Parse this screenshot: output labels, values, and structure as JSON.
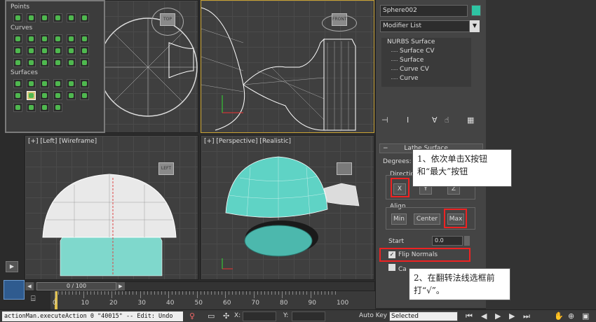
{
  "palette": {
    "points_title": "Points",
    "curves_title": "Curves",
    "surfaces_title": "Surfaces"
  },
  "viewports": {
    "left_label": "[+] [Left] [Wireframe]",
    "perspective_label": "[+] [Perspective] [Realistic]",
    "top_cube": "TOP",
    "front_cube": "FRONT",
    "left_cube": "LEFT"
  },
  "command_panel": {
    "object_name": "Sphere002",
    "modifier_list": "Modifier List",
    "stack": {
      "root": "NURBS Surface",
      "items": [
        "Surface CV",
        "Surface",
        "Curve CV",
        "Curve"
      ]
    },
    "rollout_title": "Lathe Surface",
    "degrees_label": "Degrees:",
    "direction_label": "Direction",
    "direction_buttons": [
      "X",
      "Y",
      "Z"
    ],
    "align_label": "Align",
    "align_buttons": [
      "Min",
      "Center",
      "Max"
    ],
    "start_label": "Start",
    "start_value": "0.0",
    "flip_normals_label": "Flip Normals",
    "cap_label": "Ca"
  },
  "callouts": {
    "step1": "1、依次单击X按钮和“最大”按钮",
    "step2": "2、在翻转法线选框前打“√”。"
  },
  "timeline": {
    "frame_display": "0 / 100",
    "ruler_numbers": [
      "0",
      "10",
      "20",
      "30",
      "40",
      "50",
      "60",
      "70",
      "80",
      "90",
      "100"
    ]
  },
  "status": {
    "script_text": "actionMan.executeAction 0 \"40015\"  -- Edit: Undo",
    "x_label": "X:",
    "y_label": "Y:",
    "auto_key_label": "Auto Key",
    "selected_value": "Selected"
  },
  "colors": {
    "object_color": "#2ec4a3",
    "highlight_border": "#e22222",
    "active_viewport": "#c9a232"
  }
}
